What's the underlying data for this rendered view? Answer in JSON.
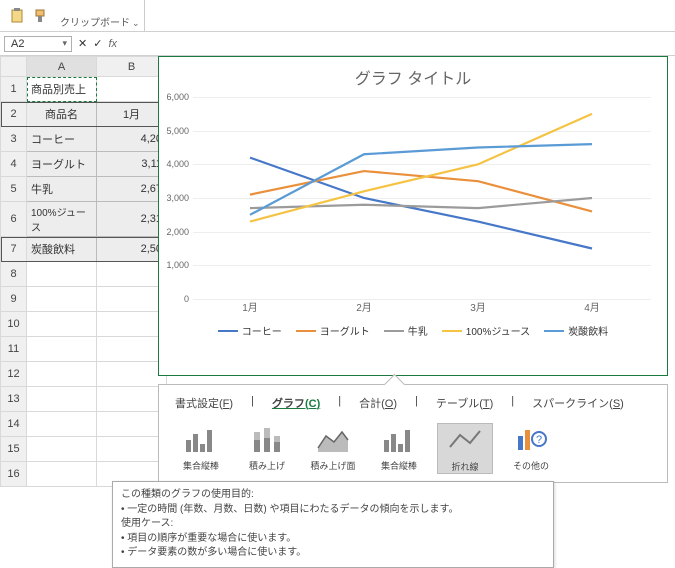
{
  "toolbar": {
    "clipboard_label": "クリップボード"
  },
  "namebox": {
    "value": "A2"
  },
  "grid": {
    "cols": [
      "A",
      "B"
    ],
    "title": "商品別売上",
    "header": {
      "name": "商品名",
      "mon": "1月"
    },
    "rows": [
      {
        "name": "コーヒー",
        "v": "4,20"
      },
      {
        "name": "ヨーグルト",
        "v": "3,11"
      },
      {
        "name": "牛乳",
        "v": "2,67"
      },
      {
        "name": "100%ジュース",
        "v": "2,31"
      },
      {
        "name": "炭酸飲料",
        "v": "2,50"
      }
    ]
  },
  "chart": {
    "title": "グラフ タイトル",
    "legend": [
      "コーヒー",
      "ヨーグルト",
      "牛乳",
      "100%ジュース",
      "炭酸飲料"
    ],
    "colors": {
      "コーヒー": "#4677c8",
      "ヨーグルト": "#ea8f3b",
      "牛乳": "#9b9b9b",
      "100%ジュース": "#f5c343",
      "炭酸飲料": "#5a9bd5"
    }
  },
  "chart_data": {
    "type": "line",
    "categories": [
      "1月",
      "2月",
      "3月",
      "4月"
    ],
    "ylim": [
      0,
      6000
    ],
    "ystep": 1000,
    "series": [
      {
        "name": "コーヒー",
        "values": [
          4200,
          3000,
          2300,
          1500
        ]
      },
      {
        "name": "ヨーグルト",
        "values": [
          3100,
          3800,
          3500,
          2600
        ]
      },
      {
        "name": "牛乳",
        "values": [
          2700,
          2800,
          2700,
          3000
        ]
      },
      {
        "name": "100%ジュース",
        "values": [
          2300,
          3200,
          4000,
          5500
        ]
      },
      {
        "name": "炭酸飲料",
        "values": [
          2500,
          4300,
          4500,
          4600
        ]
      }
    ],
    "title": "グラフ タイトル",
    "xlabel": "",
    "ylabel": ""
  },
  "callout": {
    "tabs": {
      "format": "書式設定",
      "format_u": "F",
      "chart": "グラフ",
      "chart_u": "C",
      "total": "合計",
      "total_u": "O",
      "table": "テーブル",
      "table_u": "T",
      "spark": "スパークライン",
      "spark_u": "S"
    },
    "types": {
      "clustered": "集合縦棒",
      "stacked": "積み上げ",
      "stacked100": "積み上げ面",
      "clustered2": "集合縦棒",
      "line": "折れ線",
      "other": "その他の"
    }
  },
  "tooltip": {
    "l1": "この種類のグラフの使用目的:",
    "l2": "• 一定の時間 (年数、月数、日数) や項目にわたるデータの傾向を示します。",
    "l3": "使用ケース:",
    "l4": "• 項目の順序が重要な場合に使います。",
    "l5": "• データ要素の数が多い場合に使います。"
  }
}
